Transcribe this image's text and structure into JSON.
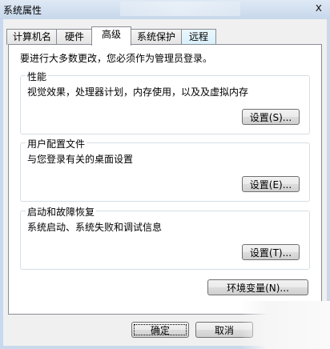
{
  "window": {
    "title": "系统属性",
    "close_glyph": "x"
  },
  "tabs": [
    {
      "label": "计算机名"
    },
    {
      "label": "硬件"
    },
    {
      "label": "高级"
    },
    {
      "label": "系统保护"
    },
    {
      "label": "远程"
    }
  ],
  "advanced": {
    "intro": "要进行大多数更改，您必须作为管理员登录。",
    "performance": {
      "title": "性能",
      "description": "视觉效果，处理器计划，内存使用，以及及虚拟内存",
      "button": "设置(S)..."
    },
    "user_profiles": {
      "title": "用户配置文件",
      "description": "与您登录有关的桌面设置",
      "button": "设置(E)..."
    },
    "startup_recovery": {
      "title": "启动和故障恢复",
      "description": "系统启动、系统失败和调试信息",
      "button": "设置(T)..."
    },
    "env_button": "环境变量(N)..."
  },
  "footer": {
    "ok": "确定",
    "cancel": "取消"
  }
}
